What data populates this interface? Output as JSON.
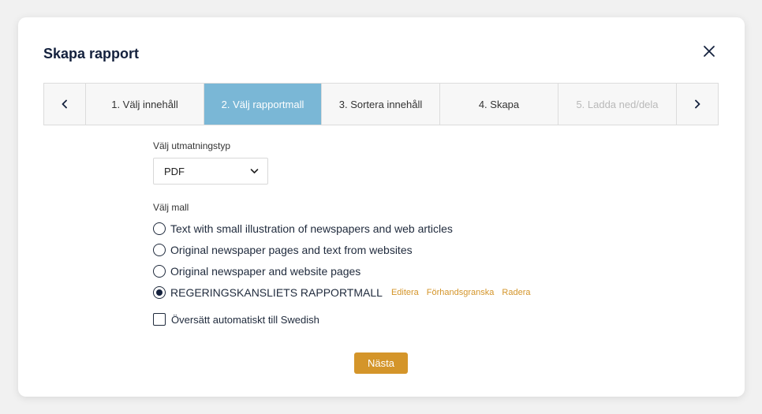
{
  "dialog": {
    "title": "Skapa rapport"
  },
  "stepper": {
    "steps": [
      {
        "label": "1. Välj innehåll",
        "state": "default"
      },
      {
        "label": "2. Välj rapportmall",
        "state": "active"
      },
      {
        "label": "3. Sortera innehåll",
        "state": "default"
      },
      {
        "label": "4. Skapa",
        "state": "default"
      },
      {
        "label": "5. Ladda ned/dela",
        "state": "disabled"
      }
    ]
  },
  "output_type": {
    "label": "Välj utmatningstyp",
    "selected": "PDF"
  },
  "template": {
    "label": "Välj mall",
    "options": [
      {
        "label": "Text with small illustration of newspapers and web articles",
        "selected": false
      },
      {
        "label": "Original newspaper pages and text from websites",
        "selected": false
      },
      {
        "label": "Original newspaper and website pages",
        "selected": false
      },
      {
        "label": "REGERINGSKANSLIETS RAPPORTMALL",
        "selected": true
      }
    ],
    "actions": {
      "edit": "Editera",
      "preview": "Förhandsgranska",
      "delete": "Radera"
    }
  },
  "translate": {
    "label": "Översätt automatiskt till Swedish",
    "checked": false
  },
  "footer": {
    "next_label": "Nästa"
  },
  "colors": {
    "accent": "#d4952a",
    "active_step": "#7ab7d6",
    "text_dark": "#14213d"
  }
}
